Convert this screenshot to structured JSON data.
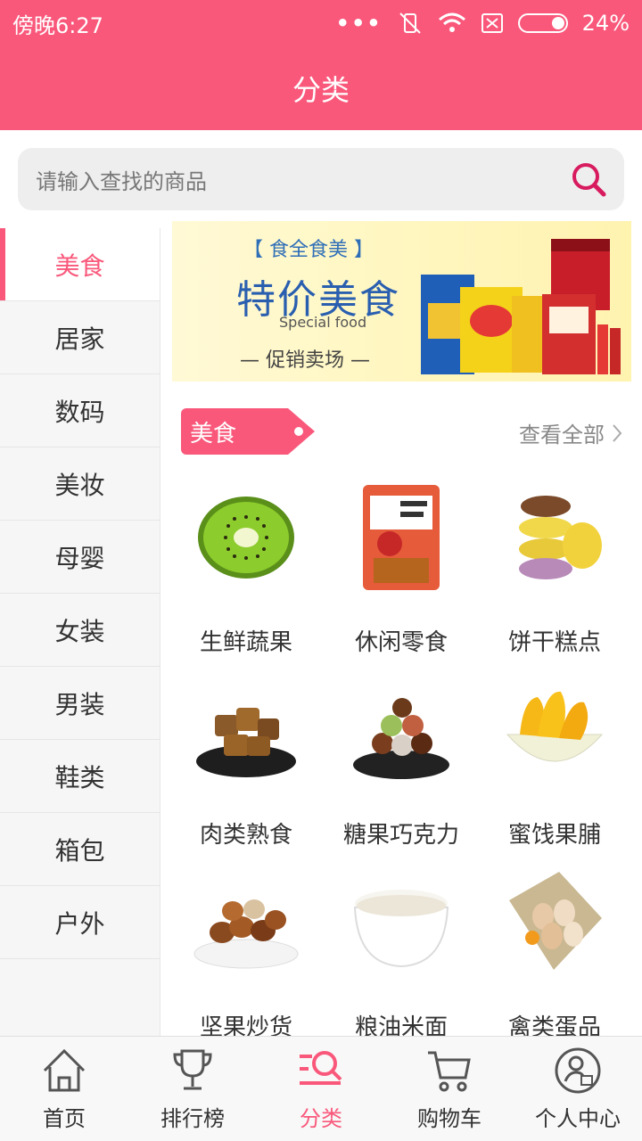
{
  "status_bar": {
    "time": "傍晚6:27",
    "battery": "24%"
  },
  "header": {
    "title": "分类"
  },
  "search": {
    "placeholder": "请输入查找的商品"
  },
  "sidebar": {
    "items": [
      {
        "label": "美食",
        "active": true
      },
      {
        "label": "居家"
      },
      {
        "label": "数码"
      },
      {
        "label": "美妆"
      },
      {
        "label": "母婴"
      },
      {
        "label": "女装"
      },
      {
        "label": "男装"
      },
      {
        "label": "鞋类"
      },
      {
        "label": "箱包"
      },
      {
        "label": "户外"
      }
    ]
  },
  "banner": {
    "tag": "【 食全食美 】",
    "title": "特价美食",
    "subtitle": "Special food",
    "promo": "— 促销卖场 —"
  },
  "section": {
    "title": "美食",
    "see_all": "查看全部"
  },
  "categories": [
    {
      "label": "生鲜蔬果",
      "icon": "kiwi-icon"
    },
    {
      "label": "休闲零食",
      "icon": "snack-bag-icon"
    },
    {
      "label": "饼干糕点",
      "icon": "macaron-icon"
    },
    {
      "label": "肉类熟食",
      "icon": "meat-icon"
    },
    {
      "label": "糖果巧克力",
      "icon": "chocolate-icon"
    },
    {
      "label": "蜜饯果脯",
      "icon": "dried-mango-icon"
    },
    {
      "label": "坚果炒货",
      "icon": "nuts-icon"
    },
    {
      "label": "粮油米面",
      "icon": "rice-bowl-icon"
    },
    {
      "label": "禽类蛋品",
      "icon": "eggs-icon"
    }
  ],
  "tabbar": {
    "items": [
      {
        "label": "首页",
        "icon": "home-icon"
      },
      {
        "label": "排行榜",
        "icon": "trophy-icon"
      },
      {
        "label": "分类",
        "icon": "category-icon",
        "active": true
      },
      {
        "label": "购物车",
        "icon": "cart-icon"
      },
      {
        "label": "个人中心",
        "icon": "profile-icon"
      }
    ]
  },
  "colors": {
    "accent": "#f9587b",
    "sidebar_bg": "#f6f6f6",
    "search_bg": "#eeeeee"
  }
}
